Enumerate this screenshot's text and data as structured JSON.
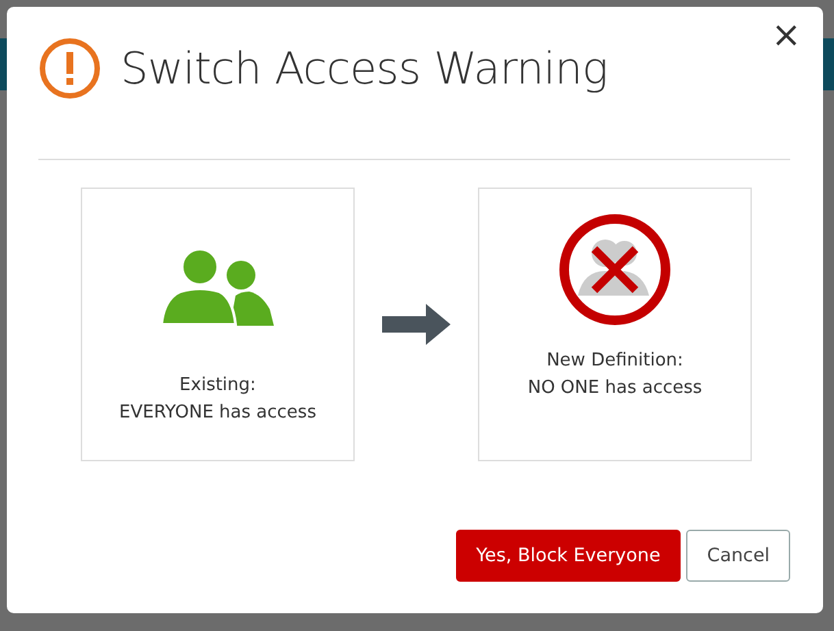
{
  "dialog": {
    "title": "Switch Access Warning",
    "close": "×"
  },
  "states": [
    {
      "kind": "allowed",
      "label": "Existing:",
      "description": "EVERYONE has access"
    },
    {
      "kind": "blocked",
      "label": "New Definition:",
      "description": "NO ONE has access"
    }
  ],
  "buttons": [
    {
      "kind": "primary",
      "label": "Yes, Block Everyone"
    },
    {
      "kind": "secondary",
      "label": "Cancel"
    }
  ]
}
